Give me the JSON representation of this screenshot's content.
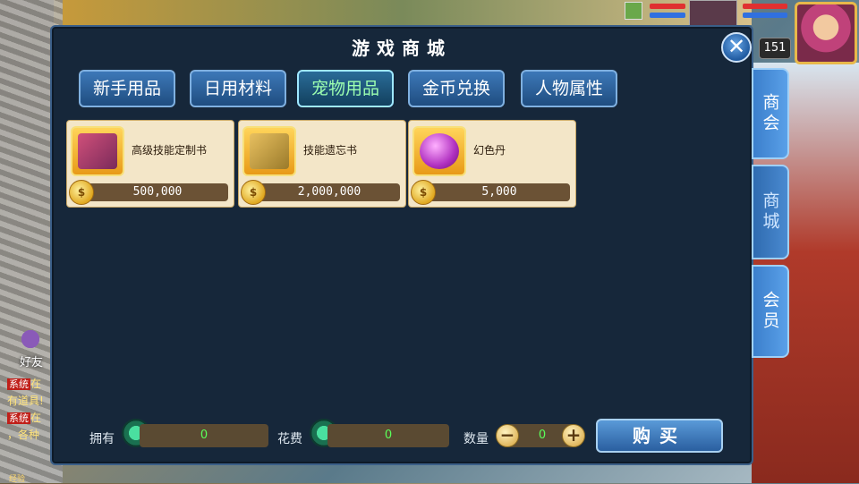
{
  "shop": {
    "title": "游戏商城",
    "tabs": [
      {
        "label": "新手用品",
        "active": false
      },
      {
        "label": "日用材料",
        "active": false
      },
      {
        "label": "宠物用品",
        "active": true
      },
      {
        "label": "金币兑换",
        "active": false
      },
      {
        "label": "人物属性",
        "active": false
      }
    ],
    "items": [
      {
        "name": "高级技能定制书",
        "price": "500,000",
        "icon": "skill-book-icon"
      },
      {
        "name": "技能遗忘书",
        "price": "2,000,000",
        "icon": "forget-book-icon"
      },
      {
        "name": "幻色丹",
        "price": "5,000",
        "icon": "purple-pill-icon"
      }
    ],
    "footer": {
      "owned_label": "拥有",
      "owned_value": "0",
      "cost_label": "花费",
      "cost_value": "0",
      "qty_label": "数量",
      "qty_value": "0",
      "buy_label": "购买"
    },
    "side_tabs": [
      {
        "label": "商会",
        "active": false
      },
      {
        "label": "商城",
        "active": true
      },
      {
        "label": "会员",
        "active": false
      }
    ],
    "close_icon": "close-icon"
  },
  "hud": {
    "level": "151"
  },
  "chat": {
    "friend_label": "好友",
    "lines": [
      {
        "tag": "系统",
        "text": "在"
      },
      {
        "tag": "",
        "text": "有道具!"
      },
      {
        "tag": "系统",
        "text": "在"
      },
      {
        "tag": "",
        "text": "，各种"
      }
    ],
    "exp_label": "经验"
  },
  "colors": {
    "panel_bg": "#16273a",
    "tab_active_text": "#9dffb0",
    "value_green": "#5aff5a"
  }
}
